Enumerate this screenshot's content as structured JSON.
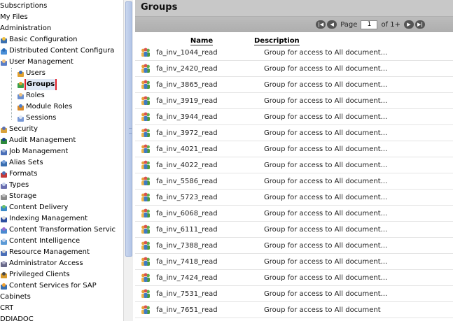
{
  "nav": {
    "items": [
      {
        "label": "Subscriptions",
        "icon": "none",
        "indent": 0
      },
      {
        "label": "My Files",
        "icon": "none",
        "indent": 0
      },
      {
        "label": "Administration",
        "icon": "none",
        "indent": 0
      },
      {
        "label": "Basic Configuration",
        "icon": "config-icon",
        "indent": 0
      },
      {
        "label": "Distributed Content Configura",
        "icon": "distributed-icon",
        "indent": 0
      },
      {
        "label": "User Management",
        "icon": "user-management-icon",
        "indent": 0
      },
      {
        "label": "Users",
        "icon": "user-icon",
        "indent": 1
      },
      {
        "label": "Groups",
        "icon": "group-icon",
        "indent": 1,
        "selected": true
      },
      {
        "label": "Roles",
        "icon": "role-icon",
        "indent": 1
      },
      {
        "label": "Module Roles",
        "icon": "module-role-icon",
        "indent": 1
      },
      {
        "label": "Sessions",
        "icon": "session-icon",
        "indent": 1
      },
      {
        "label": "Security",
        "icon": "security-icon",
        "indent": 0
      },
      {
        "label": "Audit Management",
        "icon": "audit-icon",
        "indent": 0
      },
      {
        "label": "Job Management",
        "icon": "job-icon",
        "indent": 0
      },
      {
        "label": "Alias Sets",
        "icon": "alias-icon",
        "indent": 0
      },
      {
        "label": "Formats",
        "icon": "formats-icon",
        "indent": 0
      },
      {
        "label": "Types",
        "icon": "types-icon",
        "indent": 0
      },
      {
        "label": "Storage",
        "icon": "storage-icon",
        "indent": 0
      },
      {
        "label": "Content Delivery",
        "icon": "delivery-icon",
        "indent": 0
      },
      {
        "label": "Indexing Management",
        "icon": "indexing-icon",
        "indent": 0
      },
      {
        "label": "Content Transformation Servic",
        "icon": "transformation-icon",
        "indent": 0
      },
      {
        "label": "Content Intelligence",
        "icon": "intelligence-icon",
        "indent": 0
      },
      {
        "label": "Resource Management",
        "icon": "resource-icon",
        "indent": 0
      },
      {
        "label": "Administrator Access",
        "icon": "admin-access-icon",
        "indent": 0
      },
      {
        "label": "Privileged Clients",
        "icon": "privileged-icon",
        "indent": 0
      },
      {
        "label": "Content Services for SAP",
        "icon": "sap-icon",
        "indent": 0
      },
      {
        "label": "Cabinets",
        "icon": "none",
        "indent": 0
      },
      {
        "label": "CRT",
        "icon": "none",
        "indent": 0
      },
      {
        "label": "DDIADOC",
        "icon": "none",
        "indent": 0
      }
    ]
  },
  "main": {
    "title": "Groups",
    "pager": {
      "page_label": "Page",
      "page_value": "1",
      "of_label": "of 1+"
    },
    "columns": {
      "name": "Name",
      "description": "Description"
    },
    "rows": [
      {
        "name": "fa_inv_1044_read",
        "description": "Group for access to All document..."
      },
      {
        "name": "fa_inv_2420_read",
        "description": "Group for access to All document..."
      },
      {
        "name": "fa_inv_3865_read",
        "description": "Group for access to All document..."
      },
      {
        "name": "fa_inv_3919_read",
        "description": "Group for access to All document..."
      },
      {
        "name": "fa_inv_3944_read",
        "description": "Group for access to All document..."
      },
      {
        "name": "fa_inv_3972_read",
        "description": "Group for access to All document..."
      },
      {
        "name": "fa_inv_4021_read",
        "description": "Group for access to All document..."
      },
      {
        "name": "fa_inv_4022_read",
        "description": "Group for access to All document..."
      },
      {
        "name": "fa_inv_5586_read",
        "description": "Group for access to All document..."
      },
      {
        "name": "fa_inv_5723_read",
        "description": "Group for access to All document..."
      },
      {
        "name": "fa_inv_6068_read",
        "description": "Group for access to All document..."
      },
      {
        "name": "fa_inv_6111_read",
        "description": "Group for access to All document..."
      },
      {
        "name": "fa_inv_7388_read",
        "description": "Group for access to All document..."
      },
      {
        "name": "fa_inv_7418_read",
        "description": "Group for access to All document..."
      },
      {
        "name": "fa_inv_7424_read",
        "description": "Group for access to All document..."
      },
      {
        "name": "fa_inv_7531_read",
        "description": "Group for access to All document..."
      },
      {
        "name": "fa_inv_7651_read",
        "description": "Group for access to All document"
      }
    ]
  },
  "colors": {
    "selection_outline": "#e0202a",
    "title_bar": "#c8c8c8",
    "pager_bar": "#b4b4b4"
  }
}
